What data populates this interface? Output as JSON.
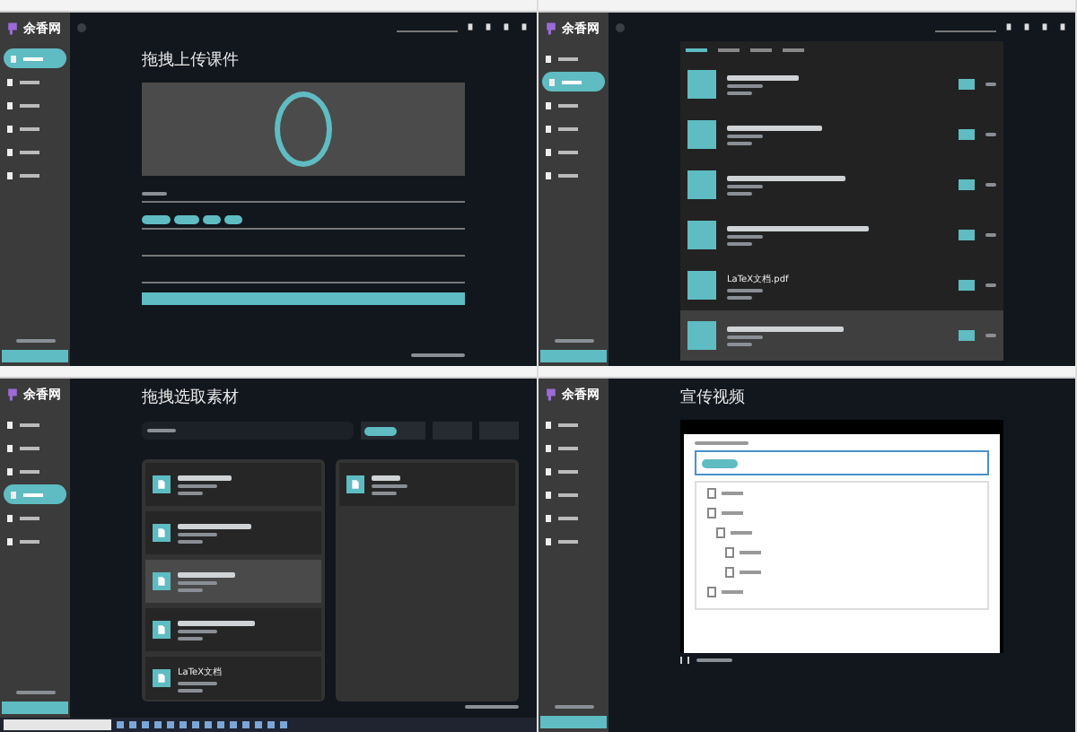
{
  "panels": [
    {
      "kind": "upload",
      "logo": "余香网",
      "heading": "拖拽上传课件",
      "nav": [
        {
          "selected": true
        },
        {
          "selected": false
        },
        {
          "selected": false
        },
        {
          "selected": false
        },
        {
          "selected": false
        },
        {
          "selected": false
        }
      ]
    },
    {
      "kind": "list",
      "logo": "余香网",
      "nav": [
        {
          "selected": false
        },
        {
          "selected": true
        },
        {
          "selected": false
        },
        {
          "selected": false
        },
        {
          "selected": false
        },
        {
          "selected": false
        }
      ],
      "tabs": [
        {
          "selected": true
        },
        {
          "selected": false
        },
        {
          "selected": false
        },
        {
          "selected": false
        }
      ],
      "items": [
        {
          "highlighted": false
        },
        {
          "highlighted": false
        },
        {
          "highlighted": false
        },
        {
          "highlighted": false
        },
        {
          "title": "LaTeX文档.pdf",
          "highlighted": false
        },
        {
          "highlighted": true
        }
      ]
    },
    {
      "kind": "picker",
      "logo": "余香网",
      "heading": "拖拽选取素材",
      "nav": [
        {
          "selected": false
        },
        {
          "selected": false
        },
        {
          "selected": false
        },
        {
          "selected": true
        },
        {
          "selected": false
        },
        {
          "selected": false
        }
      ],
      "cards": [
        {
          "highlighted": false
        },
        {
          "highlighted": false
        },
        {
          "highlighted": true
        },
        {
          "highlighted": false
        },
        {
          "title": "LaTeX文档",
          "highlighted": false
        }
      ]
    },
    {
      "kind": "video",
      "logo": "余香网",
      "heading": "宣传视频",
      "nav": [
        {
          "selected": false
        },
        {
          "selected": false
        },
        {
          "selected": false
        },
        {
          "selected": false
        },
        {
          "selected": false
        },
        {
          "selected": false
        }
      ]
    }
  ]
}
